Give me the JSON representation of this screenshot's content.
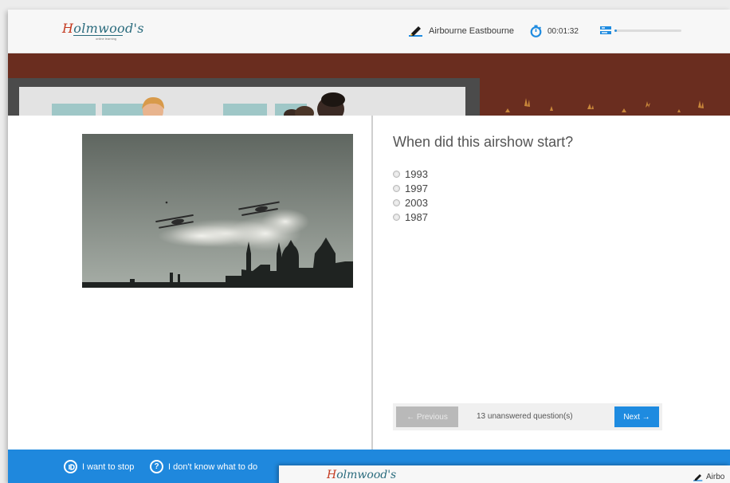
{
  "header": {
    "logo_h": "H",
    "logo_rest": "olmwood's",
    "logo_tagline": "online learning",
    "course_name": "Airbourne Eastbourne",
    "timer": "00:01:32",
    "progress_fraction": 0.04
  },
  "question": {
    "text": "When did this airshow start?",
    "options": [
      "1993",
      "1997",
      "2003",
      "1987"
    ]
  },
  "navigation": {
    "previous_label": "← Previous",
    "unanswered_text": "13 unanswered question(s)",
    "next_label": "Next →"
  },
  "footer": {
    "stop_label": "I want to stop",
    "help_label": "I don't know what to do"
  },
  "overlay": {
    "logo_h": "H",
    "logo_rest": "olmwood's",
    "course_partial": "Airbo"
  },
  "colors": {
    "accent_blue": "#1f88dd",
    "banner_brown": "#6a2d1f",
    "logo_red": "#c4391f",
    "logo_teal": "#2a6b7d"
  }
}
